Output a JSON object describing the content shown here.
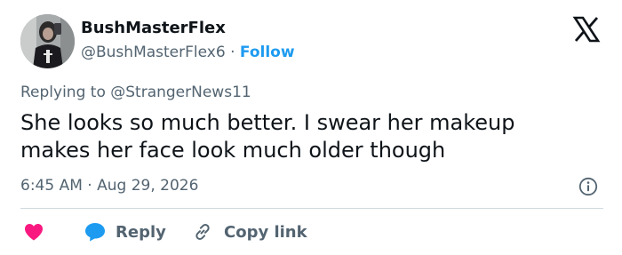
{
  "user": {
    "display_name": "BushMasterFlex",
    "handle": "@BushMasterFlex6",
    "separator": "·",
    "follow_label": "Follow"
  },
  "brand": {
    "logo": "x-logo-icon"
  },
  "reply_context": {
    "prefix": "Replying to",
    "mention": "@StrangerNews11"
  },
  "tweet": {
    "text": "She looks so much better. I swear her makeup makes her face look much older though"
  },
  "meta": {
    "time": "6:45 AM",
    "separator": "·",
    "date": "Aug 29, 2026"
  },
  "actions": {
    "like_icon": "heart-icon",
    "reply_label": "Reply",
    "copy_label": "Copy link"
  },
  "colors": {
    "accent": "#1d9bf0",
    "like": "#f91880",
    "muted_text": "#536471"
  }
}
